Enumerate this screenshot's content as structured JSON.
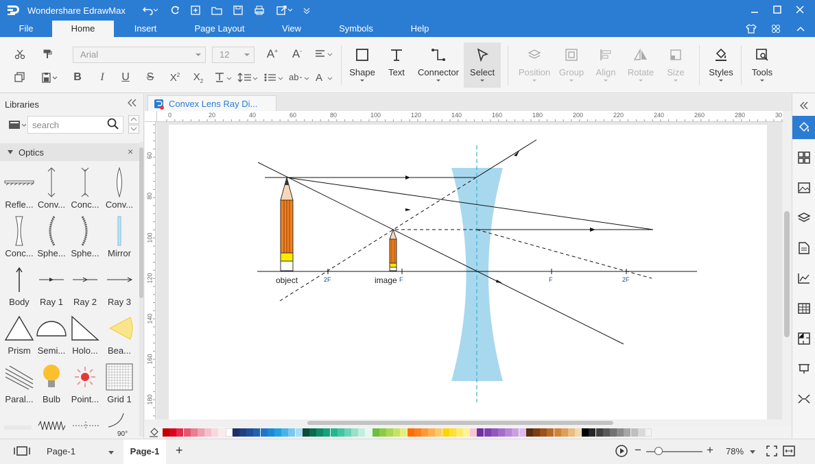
{
  "titlebar": {
    "app_title": "Wondershare EdrawMax",
    "brand_color": "#2b7cd3"
  },
  "menu": {
    "tabs": [
      "File",
      "Home",
      "Insert",
      "Page Layout",
      "View",
      "Symbols",
      "Help"
    ],
    "active": "Home"
  },
  "ribbon": {
    "font_name": "Arial",
    "font_size": "12",
    "tools": {
      "shape": "Shape",
      "text": "Text",
      "connector": "Connector",
      "select": "Select",
      "position": "Position",
      "group": "Group",
      "align": "Align",
      "rotate": "Rotate",
      "size": "Size",
      "styles": "Styles",
      "tools": "Tools"
    }
  },
  "libraries": {
    "title": "Libraries",
    "search_placeholder": "search",
    "category": "Optics",
    "shapes": [
      "Refle...",
      "Conv...",
      "Conc...",
      "Conv...",
      "Conc...",
      "Sphe...",
      "Sphe...",
      "Mirror",
      "Body",
      "Ray 1",
      "Ray 2",
      "Ray 3",
      "Prism",
      "Semi...",
      "Holo...",
      "Bea...",
      "Paral...",
      "Bulb",
      "Point...",
      "Grid 1"
    ],
    "partial_label": "90°"
  },
  "document": {
    "tab_title": "Convex Lens Ray Di...",
    "ruler_h": [
      "0",
      "20",
      "40",
      "60",
      "80",
      "100",
      "120",
      "140",
      "160",
      "180",
      "200",
      "220",
      "240",
      "260",
      "280",
      "30"
    ],
    "ruler_v": [
      "60",
      "80",
      "100",
      "120",
      "140",
      "160",
      "180"
    ]
  },
  "diagram": {
    "label_object": "object",
    "label_image": "image",
    "label_f_left": "F",
    "label_2f_left": "2F",
    "label_f_right": "F",
    "label_2f_right": "2F",
    "lens_color": "#a8d8ee",
    "axis_color": "#3ab0d0"
  },
  "status": {
    "page_select": "Page-1",
    "page_tab": "Page-1",
    "zoom": "78%"
  }
}
